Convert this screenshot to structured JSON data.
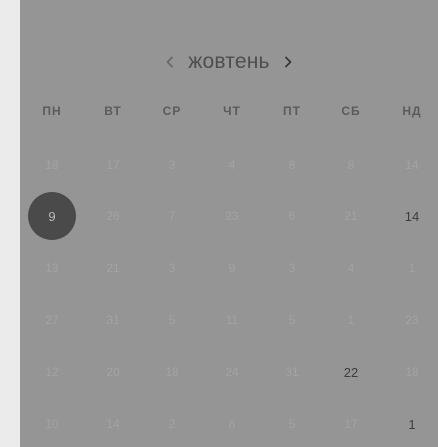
{
  "calendar": {
    "month": "жовтень",
    "prev_icon": "chevron-left-icon",
    "next_icon": "chevron-right-icon",
    "weekdays": [
      "ПН",
      "ВТ",
      "СР",
      "ЧТ",
      "ПТ",
      "СБ",
      "НД"
    ],
    "weeks": [
      [
        {
          "d": "18",
          "s": "muted"
        },
        {
          "d": "17",
          "s": "muted"
        },
        {
          "d": "3",
          "s": "muted"
        },
        {
          "d": "4",
          "s": "muted"
        },
        {
          "d": "8",
          "s": "muted"
        },
        {
          "d": "8",
          "s": "muted"
        },
        {
          "d": "14",
          "s": "muted"
        }
      ],
      [
        {
          "d": "9",
          "s": "selected"
        },
        {
          "d": "26",
          "s": "muted"
        },
        {
          "d": "7",
          "s": "muted"
        },
        {
          "d": "23",
          "s": "muted"
        },
        {
          "d": "6",
          "s": "muted"
        },
        {
          "d": "21",
          "s": "muted"
        },
        {
          "d": "14",
          "s": "active"
        }
      ],
      [
        {
          "d": "13",
          "s": "muted"
        },
        {
          "d": "21",
          "s": "muted"
        },
        {
          "d": "3",
          "s": "muted"
        },
        {
          "d": "9",
          "s": "muted"
        },
        {
          "d": "3",
          "s": "muted"
        },
        {
          "d": "4",
          "s": "muted"
        },
        {
          "d": "1",
          "s": "muted"
        }
      ],
      [
        {
          "d": "27",
          "s": "muted"
        },
        {
          "d": "31",
          "s": "muted"
        },
        {
          "d": "5",
          "s": "muted"
        },
        {
          "d": "11",
          "s": "muted"
        },
        {
          "d": "5",
          "s": "muted"
        },
        {
          "d": "1",
          "s": "muted"
        },
        {
          "d": "23",
          "s": "muted"
        }
      ],
      [
        {
          "d": "12",
          "s": "muted"
        },
        {
          "d": "20",
          "s": "muted"
        },
        {
          "d": "18",
          "s": "muted"
        },
        {
          "d": "24",
          "s": "muted"
        },
        {
          "d": "31",
          "s": "muted"
        },
        {
          "d": "22",
          "s": "active"
        },
        {
          "d": "18",
          "s": "muted"
        }
      ],
      [
        {
          "d": "10",
          "s": "muted"
        },
        {
          "d": "14",
          "s": "muted"
        },
        {
          "d": "2",
          "s": "muted"
        },
        {
          "d": "8",
          "s": "muted"
        },
        {
          "d": "5",
          "s": "muted"
        },
        {
          "d": "17",
          "s": "muted"
        },
        {
          "d": "1",
          "s": "active"
        }
      ]
    ]
  }
}
